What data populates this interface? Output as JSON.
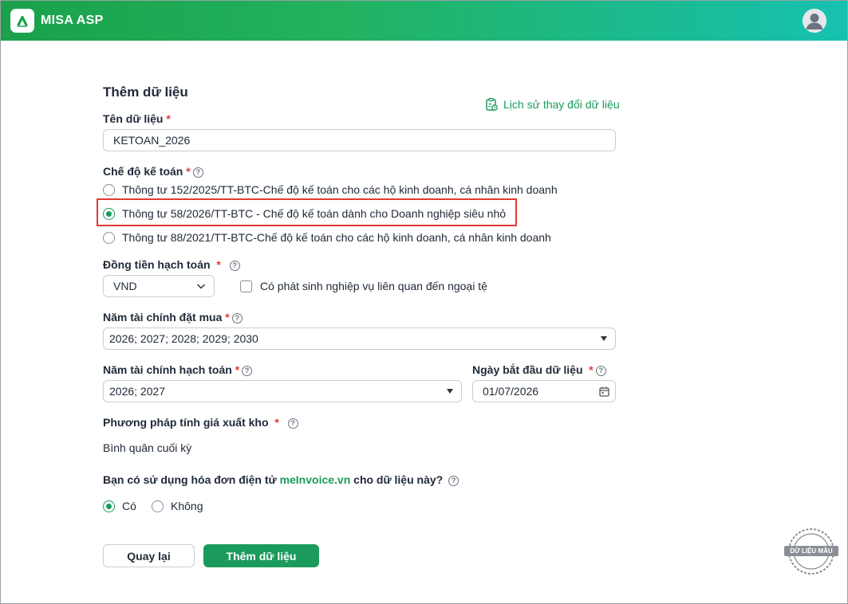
{
  "app": {
    "name": "MISA ASP"
  },
  "form": {
    "title": "Thêm dữ liệu",
    "history_link": "Lịch sử thay đổi dữ liệu",
    "name_label": "Tên dữ liệu",
    "name_value": "KETOAN_2026",
    "regime_label": "Chế độ kế toán",
    "regime_options": [
      {
        "label": "Thông tư 152/2025/TT-BTC-Chế độ kế toán cho các hộ kinh doanh, cá nhân kinh doanh",
        "selected": false
      },
      {
        "label": "Thông tư 58/2026/TT-BTC - Chế độ kế toán dành cho Doanh nghiệp siêu nhỏ",
        "selected": true
      },
      {
        "label": "Thông tư 88/2021/TT-BTC-Chế độ kế toán cho các hộ kinh doanh, cá nhân kinh doanh",
        "selected": false
      }
    ],
    "currency_label": "Đồng tiền hạch toán",
    "currency_value": "VND",
    "foreign_currency_checkbox": "Có phát sinh nghiệp vụ liên quan đến ngoại tệ",
    "purchase_years_label": "Năm tài chính đặt mua",
    "purchase_years_value": "2026; 2027; 2028; 2029; 2030",
    "accounting_years_label": "Năm tài chính hạch toán",
    "accounting_years_value": "2026; 2027",
    "start_date_label": "Ngày bắt đầu dữ liệu",
    "start_date_value": "01/07/2026",
    "inventory_method_label": "Phương pháp tính giá xuất kho",
    "inventory_method_value": "Bình quân cuối kỳ",
    "einvoice_question_prefix": "Bạn có sử dụng hóa đơn điện tử",
    "einvoice_brand": "meInvoice.vn",
    "einvoice_question_suffix": "cho dữ liệu này?",
    "einvoice_options": [
      {
        "label": "Có",
        "selected": true
      },
      {
        "label": "Không",
        "selected": false
      }
    ],
    "back_button": "Quay lại",
    "submit_button": "Thêm dữ liệu"
  },
  "stamp_text": "DỮ LIỆU MẪU",
  "colors": {
    "brand_green": "#1a9a5c",
    "required_red": "#e53935",
    "highlight_red": "#e03b33"
  }
}
